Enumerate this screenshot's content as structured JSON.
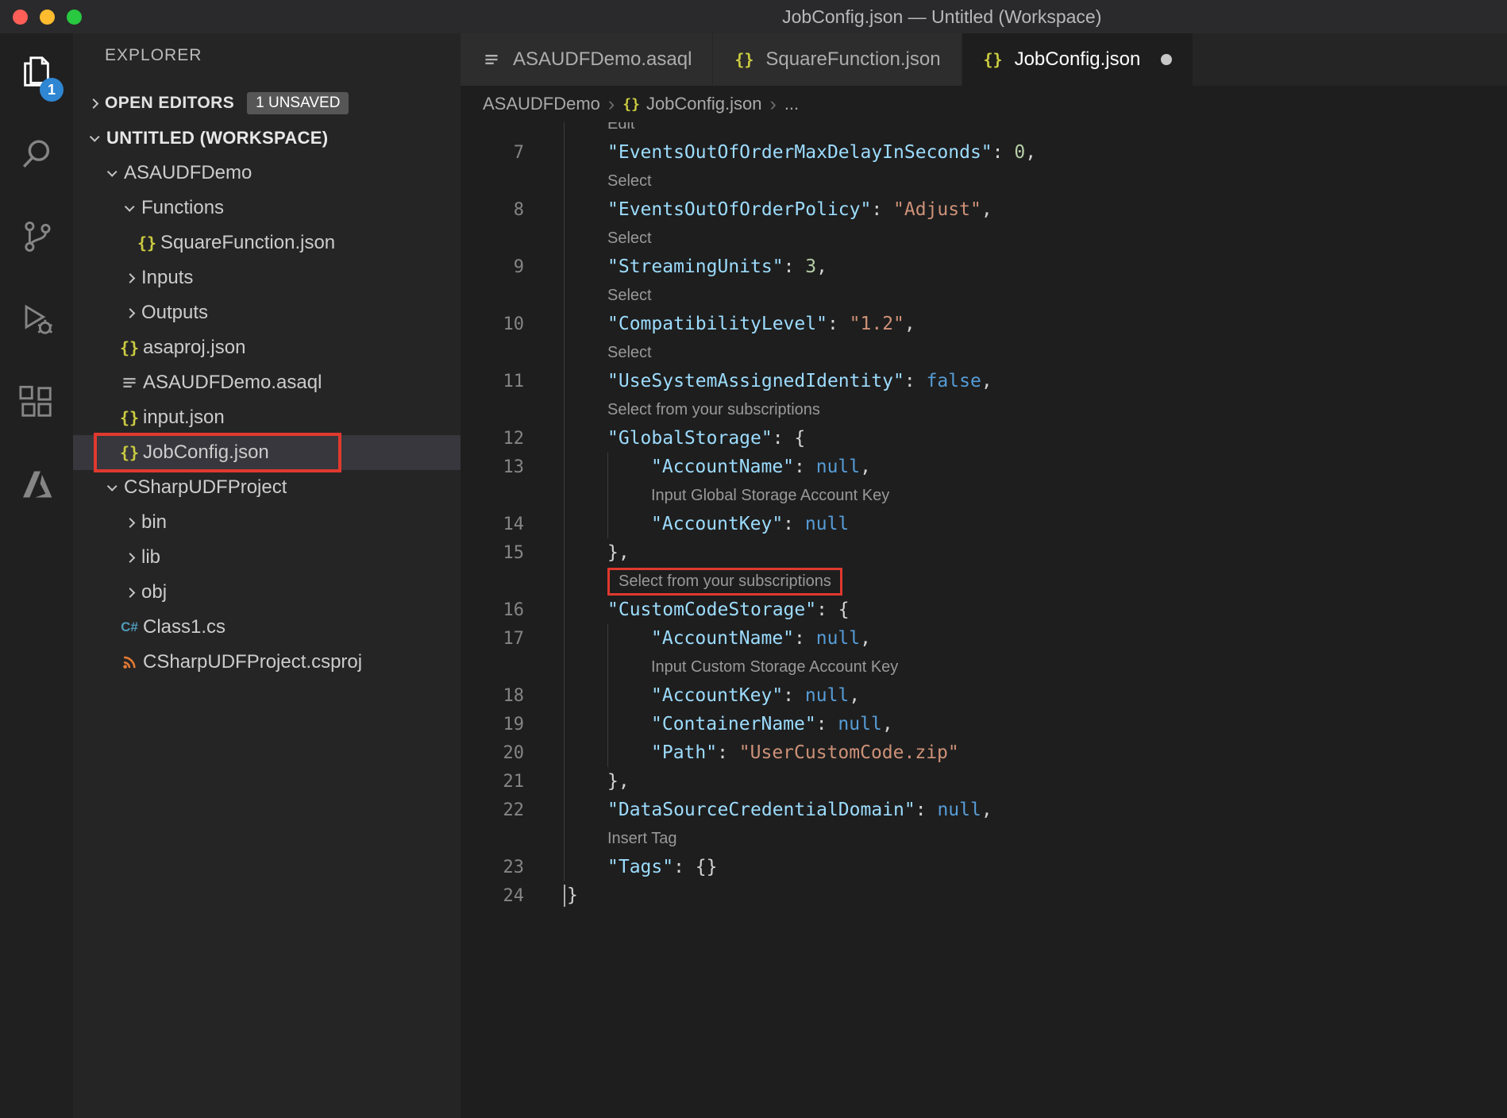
{
  "window": {
    "title": "JobConfig.json — Untitled (Workspace)"
  },
  "colors": {
    "annotation": "#e0392e",
    "key": "#9cdcfe",
    "string": "#ce9178",
    "number": "#b5cea8",
    "keyword": "#569cd6",
    "punct": "#d4d4d4",
    "codelens": "#999999",
    "badge_blue": "#2f86d2",
    "json_icon": "#cbcb41",
    "csproj_icon": "#e37933"
  },
  "activity_bar": {
    "items": [
      {
        "name": "explorer",
        "active": true,
        "badge": "1"
      },
      {
        "name": "search",
        "active": false
      },
      {
        "name": "source-control",
        "active": false
      },
      {
        "name": "run-debug",
        "active": false
      },
      {
        "name": "extensions",
        "active": false
      },
      {
        "name": "azure",
        "active": false
      }
    ]
  },
  "sidebar": {
    "header": "EXPLORER",
    "open_editors": {
      "label": "OPEN EDITORS",
      "badge": "1 UNSAVED"
    },
    "tree": [
      {
        "label": "UNTITLED (WORKSPACE)",
        "indent": 0,
        "chevron": "down",
        "bold": true
      },
      {
        "label": "ASAUDFDemo",
        "indent": 1,
        "chevron": "down"
      },
      {
        "label": "Functions",
        "indent": 2,
        "chevron": "down"
      },
      {
        "label": "SquareFunction.json",
        "indent": 3,
        "icon": "json"
      },
      {
        "label": "Inputs",
        "indent": 2,
        "chevron": "right"
      },
      {
        "label": "Outputs",
        "indent": 2,
        "chevron": "right"
      },
      {
        "label": "asaproj.json",
        "indent": 2,
        "icon": "json"
      },
      {
        "label": "ASAUDFDemo.asaql",
        "indent": 2,
        "icon": "list"
      },
      {
        "label": "input.json",
        "indent": 2,
        "icon": "json"
      },
      {
        "label": "JobConfig.json",
        "indent": 2,
        "icon": "json",
        "selected": true,
        "highlight_box": true
      },
      {
        "label": "CSharpUDFProject",
        "indent": 1,
        "chevron": "down"
      },
      {
        "label": "bin",
        "indent": 2,
        "chevron": "right"
      },
      {
        "label": "lib",
        "indent": 2,
        "chevron": "right"
      },
      {
        "label": "obj",
        "indent": 2,
        "chevron": "right"
      },
      {
        "label": "Class1.cs",
        "indent": 2,
        "icon": "csharp"
      },
      {
        "label": "CSharpUDFProject.csproj",
        "indent": 2,
        "icon": "rss"
      }
    ]
  },
  "editor": {
    "tabs": [
      {
        "label": "ASAUDFDemo.asaql",
        "icon": "list",
        "active": false,
        "modified": false
      },
      {
        "label": "SquareFunction.json",
        "icon": "json",
        "active": false,
        "modified": false
      },
      {
        "label": "JobConfig.json",
        "icon": "json",
        "active": true,
        "modified": true
      }
    ],
    "breadcrumb": [
      {
        "label": "ASAUDFDemo"
      },
      {
        "label": "JobConfig.json",
        "icon": "json"
      },
      {
        "label": "..."
      }
    ],
    "lines": [
      {
        "type": "lens",
        "text": "Edit",
        "indent": 1,
        "clipped": true
      },
      {
        "type": "code",
        "num": 7,
        "indent": 1,
        "tokens": [
          [
            "k",
            "\"EventsOutOfOrderMaxDelayInSeconds\""
          ],
          [
            "p",
            ": "
          ],
          [
            "n",
            "0"
          ],
          [
            "p",
            ","
          ]
        ]
      },
      {
        "type": "lens",
        "text": "Select",
        "indent": 1
      },
      {
        "type": "code",
        "num": 8,
        "indent": 1,
        "tokens": [
          [
            "k",
            "\"EventsOutOfOrderPolicy\""
          ],
          [
            "p",
            ": "
          ],
          [
            "s",
            "\"Adjust\""
          ],
          [
            "p",
            ","
          ]
        ]
      },
      {
        "type": "lens",
        "text": "Select",
        "indent": 1
      },
      {
        "type": "code",
        "num": 9,
        "indent": 1,
        "tokens": [
          [
            "k",
            "\"StreamingUnits\""
          ],
          [
            "p",
            ": "
          ],
          [
            "n",
            "3"
          ],
          [
            "p",
            ","
          ]
        ]
      },
      {
        "type": "lens",
        "text": "Select",
        "indent": 1
      },
      {
        "type": "code",
        "num": 10,
        "indent": 1,
        "tokens": [
          [
            "k",
            "\"CompatibilityLevel\""
          ],
          [
            "p",
            ": "
          ],
          [
            "s",
            "\"1.2\""
          ],
          [
            "p",
            ","
          ]
        ]
      },
      {
        "type": "lens",
        "text": "Select",
        "indent": 1
      },
      {
        "type": "code",
        "num": 11,
        "indent": 1,
        "tokens": [
          [
            "k",
            "\"UseSystemAssignedIdentity\""
          ],
          [
            "p",
            ": "
          ],
          [
            "b",
            "false"
          ],
          [
            "p",
            ","
          ]
        ]
      },
      {
        "type": "lens",
        "text": "Select from your subscriptions",
        "indent": 1
      },
      {
        "type": "code",
        "num": 12,
        "indent": 1,
        "tokens": [
          [
            "k",
            "\"GlobalStorage\""
          ],
          [
            "p",
            ": {"
          ]
        ]
      },
      {
        "type": "code",
        "num": 13,
        "indent": 2,
        "tokens": [
          [
            "k",
            "\"AccountName\""
          ],
          [
            "p",
            ": "
          ],
          [
            "b",
            "null"
          ],
          [
            "p",
            ","
          ]
        ]
      },
      {
        "type": "lens",
        "text": "Input Global Storage Account Key",
        "indent": 2
      },
      {
        "type": "code",
        "num": 14,
        "indent": 2,
        "tokens": [
          [
            "k",
            "\"AccountKey\""
          ],
          [
            "p",
            ": "
          ],
          [
            "b",
            "null"
          ]
        ]
      },
      {
        "type": "code",
        "num": 15,
        "indent": 1,
        "tokens": [
          [
            "p",
            "},"
          ]
        ]
      },
      {
        "type": "lens",
        "text": "Select from your subscriptions",
        "indent": 1,
        "boxed": true
      },
      {
        "type": "code",
        "num": 16,
        "indent": 1,
        "tokens": [
          [
            "k",
            "\"CustomCodeStorage\""
          ],
          [
            "p",
            ": {"
          ]
        ]
      },
      {
        "type": "code",
        "num": 17,
        "indent": 2,
        "tokens": [
          [
            "k",
            "\"AccountName\""
          ],
          [
            "p",
            ": "
          ],
          [
            "b",
            "null"
          ],
          [
            "p",
            ","
          ]
        ]
      },
      {
        "type": "lens",
        "text": "Input Custom Storage Account Key",
        "indent": 2
      },
      {
        "type": "code",
        "num": 18,
        "indent": 2,
        "tokens": [
          [
            "k",
            "\"AccountKey\""
          ],
          [
            "p",
            ": "
          ],
          [
            "b",
            "null"
          ],
          [
            "p",
            ","
          ]
        ]
      },
      {
        "type": "code",
        "num": 19,
        "indent": 2,
        "tokens": [
          [
            "k",
            "\"ContainerName\""
          ],
          [
            "p",
            ": "
          ],
          [
            "b",
            "null"
          ],
          [
            "p",
            ","
          ]
        ]
      },
      {
        "type": "code",
        "num": 20,
        "indent": 2,
        "tokens": [
          [
            "k",
            "\"Path\""
          ],
          [
            "p",
            ": "
          ],
          [
            "s",
            "\"UserCustomCode.zip\""
          ]
        ]
      },
      {
        "type": "code",
        "num": 21,
        "indent": 1,
        "tokens": [
          [
            "p",
            "},"
          ]
        ]
      },
      {
        "type": "code",
        "num": 22,
        "indent": 1,
        "tokens": [
          [
            "k",
            "\"DataSourceCredentialDomain\""
          ],
          [
            "p",
            ": "
          ],
          [
            "b",
            "null"
          ],
          [
            "p",
            ","
          ]
        ]
      },
      {
        "type": "lens",
        "text": "Insert Tag",
        "indent": 1
      },
      {
        "type": "code",
        "num": 23,
        "indent": 1,
        "tokens": [
          [
            "k",
            "\"Tags\""
          ],
          [
            "p",
            ": {}"
          ]
        ]
      },
      {
        "type": "code",
        "num": 24,
        "indent": 0,
        "cursor": true,
        "tokens": [
          [
            "p",
            "}"
          ]
        ]
      }
    ]
  }
}
